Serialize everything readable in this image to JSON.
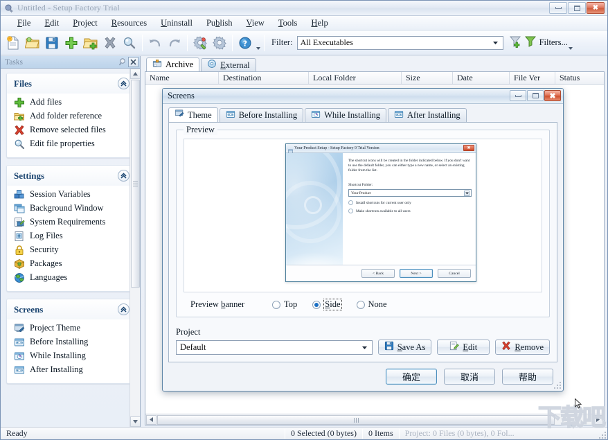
{
  "window": {
    "title": "Untitled - Setup Factory Trial",
    "app_icon": "setup-factory-icon",
    "minimize": "minimize-icon",
    "maximize": "maximize-icon",
    "close": "close-icon"
  },
  "menu": {
    "items": [
      {
        "label": "File",
        "accel": "F"
      },
      {
        "label": "Edit",
        "accel": "E"
      },
      {
        "label": "Project",
        "accel": "P"
      },
      {
        "label": "Resources",
        "accel": "R"
      },
      {
        "label": "Uninstall",
        "accel": "U"
      },
      {
        "label": "Publish",
        "accel": "b"
      },
      {
        "label": "View",
        "accel": "V"
      },
      {
        "label": "Tools",
        "accel": "T"
      },
      {
        "label": "Help",
        "accel": "H"
      }
    ]
  },
  "toolbar": {
    "buttons": [
      {
        "name": "new-project-icon",
        "tip": "New"
      },
      {
        "name": "open-project-icon",
        "tip": "Open"
      },
      {
        "name": "save-project-icon",
        "tip": "Save"
      },
      {
        "name": "add-files-icon",
        "tip": "Add files"
      },
      {
        "name": "add-folder-icon",
        "tip": "Add folder"
      },
      {
        "name": "remove-files-icon",
        "tip": "Remove"
      },
      {
        "name": "file-properties-icon",
        "tip": "Properties"
      },
      {
        "name": "undo-icon",
        "tip": "Undo"
      },
      {
        "name": "redo-icon",
        "tip": "Redo"
      },
      {
        "name": "build-settings-icon",
        "tip": "Build settings"
      },
      {
        "name": "build-icon",
        "tip": "Build"
      },
      {
        "name": "help-icon",
        "tip": "Help"
      }
    ],
    "filter_label": "Filter:",
    "filter_value": "All Executables",
    "filters_label": "Filters...",
    "add-filter-icon": "add-filter-icon",
    "filters-icon": "filter-icon"
  },
  "sidebar": {
    "header": "Tasks",
    "pin_icon": "pin-icon",
    "close_icon": "close-icon",
    "panels": [
      {
        "title": "Files",
        "items": [
          {
            "label": "Add files",
            "icon": "plus-green-icon"
          },
          {
            "label": "Add folder reference",
            "icon": "folder-add-icon"
          },
          {
            "label": "Remove selected files",
            "icon": "red-x-icon"
          },
          {
            "label": "Edit file properties",
            "icon": "magnifier-icon"
          }
        ]
      },
      {
        "title": "Settings",
        "items": [
          {
            "label": "Session Variables",
            "icon": "blocks-icon"
          },
          {
            "label": "Background Window",
            "icon": "window-icon"
          },
          {
            "label": "System Requirements",
            "icon": "system-req-icon"
          },
          {
            "label": "Log Files",
            "icon": "log-file-icon"
          },
          {
            "label": "Security",
            "icon": "padlock-icon"
          },
          {
            "label": "Packages",
            "icon": "package-icon"
          },
          {
            "label": "Languages",
            "icon": "globe-icon"
          }
        ]
      },
      {
        "title": "Screens",
        "items": [
          {
            "label": "Project Theme",
            "icon": "theme-icon"
          },
          {
            "label": "Before Installing",
            "icon": "screen-icon"
          },
          {
            "label": "While Installing",
            "icon": "progress-screen-icon"
          },
          {
            "label": "After Installing",
            "icon": "screen-icon"
          }
        ]
      }
    ]
  },
  "main": {
    "tabs": [
      {
        "label": "Archive",
        "icon": "archive-icon",
        "active": true
      },
      {
        "label": "External",
        "icon": "external-icon",
        "active": false,
        "accel": "E"
      }
    ],
    "columns": [
      {
        "label": "Name",
        "width": 106
      },
      {
        "label": "Destination",
        "width": 130
      },
      {
        "label": "Local Folder",
        "width": 134
      },
      {
        "label": "Size",
        "width": 74
      },
      {
        "label": "Date",
        "width": 82
      },
      {
        "label": "File Ver",
        "width": 66
      },
      {
        "label": "Status",
        "width": 60
      }
    ],
    "rows": []
  },
  "dialog": {
    "title": "Screens",
    "minimize": "minimize-icon",
    "maximize": "maximize-icon",
    "close": "close-icon",
    "tabs": [
      {
        "label": "Theme",
        "icon": "theme-icon",
        "active": true
      },
      {
        "label": "Before Installing",
        "icon": "screen-icon",
        "active": false
      },
      {
        "label": "While Installing",
        "icon": "progress-screen-icon",
        "active": false
      },
      {
        "label": "After Installing",
        "icon": "screen-icon",
        "active": false
      }
    ],
    "preview_group_title": "Preview",
    "mini": {
      "title": "Your Product Setup - Setup Factory 9 Trial Version",
      "icon": "setup-icon",
      "close": "close-icon",
      "paragraph": "The shortcut icons will be created in the folder indicated below. If you don't want to use the default folder, you can either type a new name, or select an existing folder from the list.",
      "field_label": "Shortcut Folder:",
      "field_value": "Your Product",
      "radios": [
        {
          "label": "Install shortcuts for current user only",
          "selected": false
        },
        {
          "label": "Make shortcuts available to all users",
          "selected": false
        }
      ],
      "buttons": [
        {
          "label": "< Back",
          "default": false
        },
        {
          "label": "Next >",
          "default": true
        },
        {
          "label": "Cancel",
          "default": false
        }
      ]
    },
    "banner_row": {
      "label": "Preview banner",
      "accel": "b",
      "options": [
        {
          "label": "Top",
          "selected": false
        },
        {
          "label": "Side",
          "selected": true,
          "focused": true
        },
        {
          "label": "None",
          "selected": false
        }
      ]
    },
    "project": {
      "title": "Project",
      "value": "Default",
      "buttons": [
        {
          "label": "Save As",
          "accel": "S",
          "icon": "save-icon"
        },
        {
          "label": "Edit",
          "accel": "E",
          "icon": "edit-icon"
        },
        {
          "label": "Remove",
          "accel": "R",
          "icon": "red-x-icon"
        }
      ]
    },
    "footer_buttons": [
      {
        "label": "确定",
        "default": true,
        "name": "ok-button"
      },
      {
        "label": "取消",
        "default": false,
        "name": "cancel-button"
      },
      {
        "label": "帮助",
        "default": false,
        "name": "help-button"
      }
    ]
  },
  "statusbar": {
    "ready": "Ready",
    "selected": "0 Selected  (0 bytes)",
    "items": "0 Items",
    "project_info": "Project:  0 Files  (0 bytes),  0 Fol..."
  },
  "watermark": "下载吧"
}
